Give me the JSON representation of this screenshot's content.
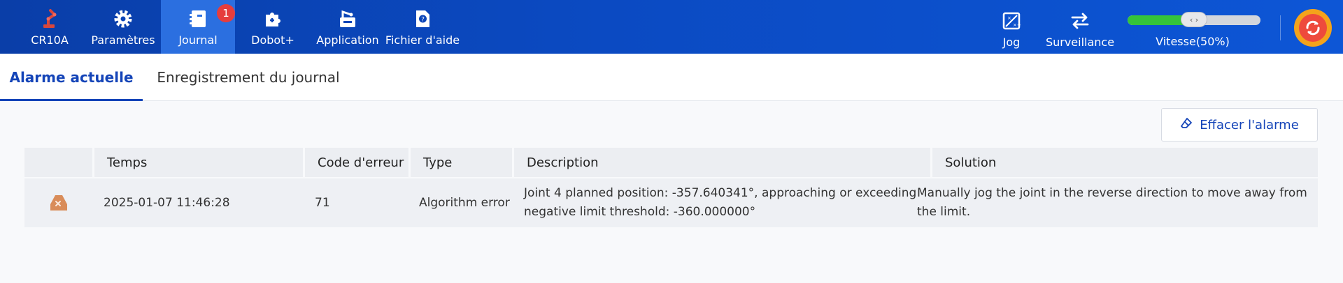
{
  "nav": {
    "items": [
      {
        "label": "CR10A",
        "icon": "robot-arm-icon"
      },
      {
        "label": "Paramètres",
        "icon": "gear-icon"
      },
      {
        "label": "Journal",
        "icon": "notebook-icon",
        "badge": "1",
        "active": true
      },
      {
        "label": "Dobot+",
        "icon": "puzzle-icon"
      },
      {
        "label": "Application",
        "icon": "application-icon"
      },
      {
        "label": "Fichier d'aide",
        "icon": "help-file-icon"
      }
    ],
    "right_items": [
      {
        "label": "Jog",
        "icon": "jog-icon"
      },
      {
        "label": "Surveillance",
        "icon": "swap-arrows-icon"
      }
    ],
    "speed": {
      "label": "Vitesse(50%)",
      "value_percent": 50
    },
    "colors": {
      "bar": "#0b4ac2",
      "active": "#2b6fe0",
      "badge": "#e63d3d",
      "speed_fill": "#35c43a"
    }
  },
  "tabs": [
    {
      "label": "Alarme actuelle",
      "active": true
    },
    {
      "label": "Enregistrement du journal",
      "active": false
    }
  ],
  "toolbar": {
    "clear_label": "Effacer l'alarme"
  },
  "table": {
    "columns": [
      "",
      "Temps",
      "Code d'erreur",
      "Type",
      "Description",
      "Solution"
    ],
    "rows": [
      {
        "icon": "alarm-warning-icon",
        "time": "2025-01-07 11:46:28",
        "code": "71",
        "type": "Algorithm error",
        "description": "Joint 4 planned position: -357.640341°, approaching or exceeding negative limit threshold: -360.000000°",
        "solution": "Manually jog the joint in the reverse direction to move away from the limit."
      }
    ]
  }
}
